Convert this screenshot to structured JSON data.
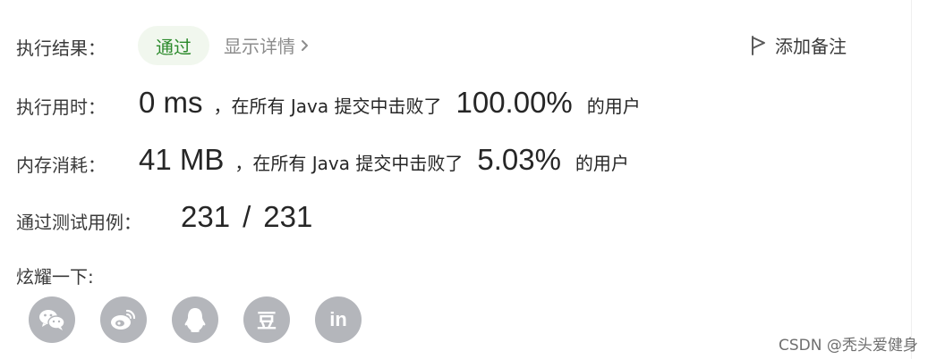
{
  "result": {
    "label": "执行结果：",
    "status": "通过",
    "details_link": "显示详情",
    "add_note": "添加备注"
  },
  "runtime": {
    "label": "执行用时：",
    "value": "0 ms",
    "sentence": "，在所有 Java 提交中击败了",
    "percent": "100.00%",
    "suffix": "的用户"
  },
  "memory": {
    "label": "内存消耗：",
    "value": "41 MB",
    "sentence": "，在所有 Java 提交中击败了",
    "percent": "5.03%",
    "suffix": "的用户"
  },
  "testcases": {
    "label": "通过测试用例：",
    "passed": "231",
    "separator": "/",
    "total": "231"
  },
  "share": {
    "label": "炫耀一下:",
    "buttons": [
      {
        "icon": "wechat-icon",
        "text": ""
      },
      {
        "icon": "weibo-icon",
        "text": ""
      },
      {
        "icon": "qq-icon",
        "text": ""
      },
      {
        "icon": "douban-icon",
        "text": "豆"
      },
      {
        "icon": "linkedin-icon",
        "text": "in"
      }
    ]
  },
  "watermark": "CSDN @秃头爱健身",
  "colors": {
    "status_bg": "#f1f7ee",
    "status_text": "#2c8a2c",
    "share_bg": "#b4b6bb",
    "muted_text": "#8c8c8c"
  }
}
